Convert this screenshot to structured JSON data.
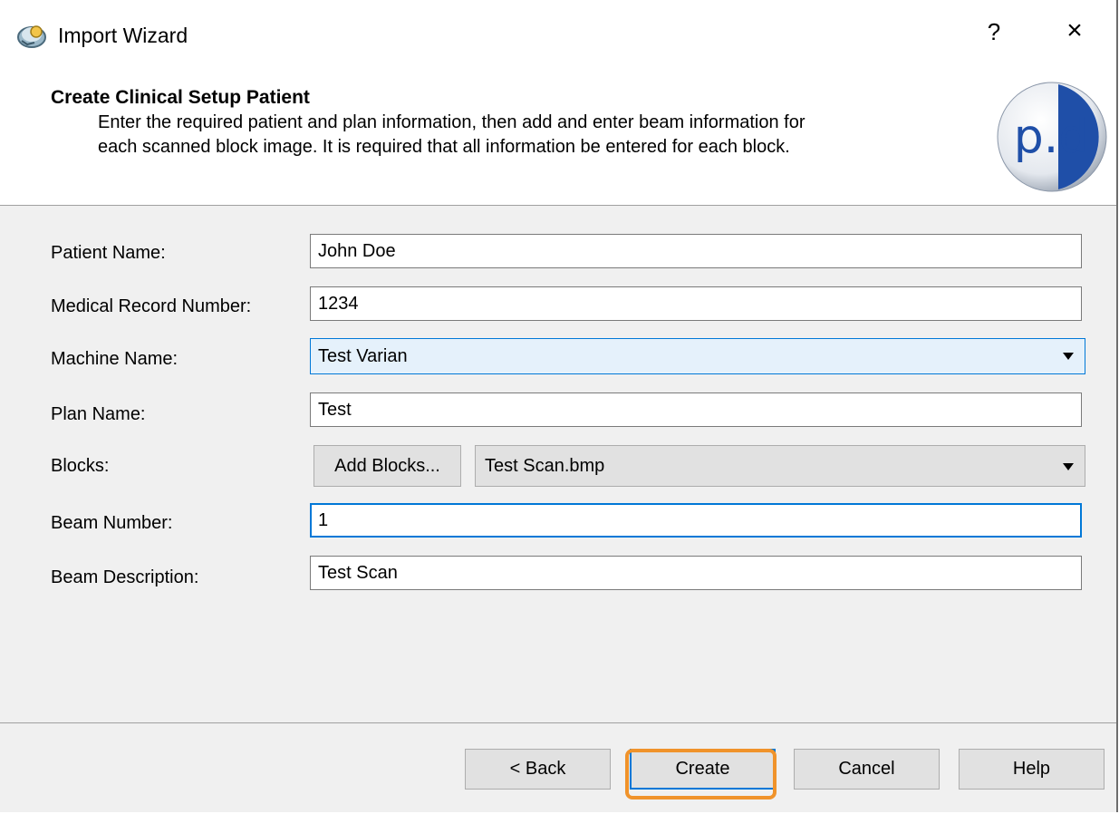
{
  "window": {
    "title": "Import Wizard",
    "help_glyph": "?",
    "close_glyph": "×"
  },
  "header": {
    "title": "Create Clinical Setup Patient",
    "description_line1": "Enter the required patient and plan information, then add and enter beam information for",
    "description_line2": "each scanned block image. It is required that all information be entered for each block.",
    "logo_text": "p.d"
  },
  "form": {
    "patient_name": {
      "label": "Patient Name:",
      "value": "John Doe"
    },
    "mrn": {
      "label": "Medical Record Number:",
      "value": "1234"
    },
    "machine_name": {
      "label": "Machine Name:",
      "value": "Test Varian"
    },
    "plan_name": {
      "label": "Plan Name:",
      "value": "Test"
    },
    "blocks": {
      "label": "Blocks:",
      "add_button": "Add Blocks...",
      "selected": "Test Scan.bmp"
    },
    "beam_number": {
      "label": "Beam Number:",
      "value": "1"
    },
    "beam_description": {
      "label": "Beam Description:",
      "value": "Test Scan"
    }
  },
  "footer": {
    "back": "< Back",
    "create": "Create",
    "cancel": "Cancel",
    "help": "Help"
  },
  "colors": {
    "focus_accent": "#0078d7",
    "highlight_outline": "#f0932b",
    "logo_blue": "#1f4fa8"
  },
  "icons": {
    "app": "import-wizard-icon",
    "dropdown": "chevron-down-icon"
  }
}
